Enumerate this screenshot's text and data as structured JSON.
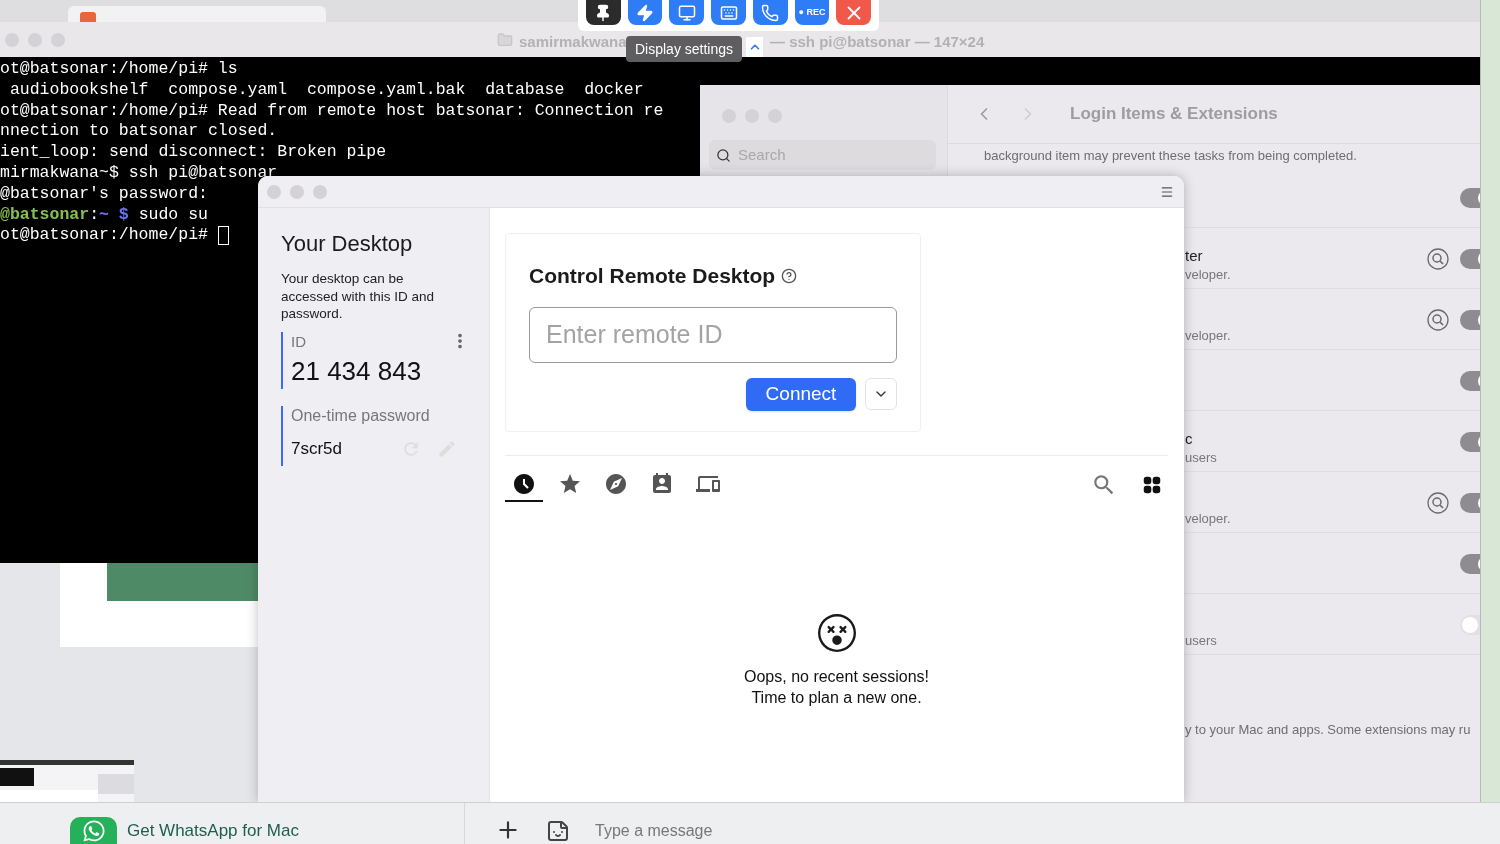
{
  "toolbar": {
    "buttons": [
      {
        "kind": "pin"
      },
      {
        "kind": "action"
      },
      {
        "kind": "display"
      },
      {
        "kind": "keyboard"
      },
      {
        "kind": "chat"
      },
      {
        "kind": "record",
        "label": "● REC"
      },
      {
        "kind": "close"
      }
    ],
    "tooltip": "Display settings"
  },
  "terminal": {
    "title_left": "samirmakwana",
    "title_right": "— ssh pi@batsonar — 147×24",
    "lines": [
      {
        "segments": [
          {
            "kind": "plain",
            "text": "ot@batsonar:/home/pi# ls"
          }
        ]
      },
      {
        "segments": [
          {
            "kind": "plain",
            "text": " audiobookshelf  compose.yaml  compose.yaml.bak  database  docker"
          }
        ]
      },
      {
        "segments": [
          {
            "kind": "plain",
            "text": "ot@batsonar:/home/pi# Read from remote host batsonar: Connection re"
          }
        ]
      },
      {
        "segments": [
          {
            "kind": "plain",
            "text": "nnection to batsonar closed."
          }
        ]
      },
      {
        "segments": [
          {
            "kind": "plain",
            "text": "ient_loop: send disconnect: Broken pipe"
          }
        ]
      },
      {
        "segments": [
          {
            "kind": "plain",
            "text": "mirmakwana~$ ssh pi@batsonar"
          }
        ]
      },
      {
        "segments": [
          {
            "kind": "plain",
            "text": "@batsonar's password:"
          }
        ]
      },
      {
        "segments": [
          {
            "kind": "host",
            "text": "@batsonar"
          },
          {
            "kind": "plain",
            "text": ":"
          },
          {
            "kind": "path",
            "text": "~ $"
          },
          {
            "kind": "plain",
            "text": " sudo su"
          }
        ]
      },
      {
        "segments": [
          {
            "kind": "plain",
            "text": "ot@batsonar:/home/pi# "
          }
        ],
        "cursor": true
      }
    ]
  },
  "settings": {
    "search_placeholder": "Search",
    "title": "Login Items & Extensions",
    "intro": "background item may prevent these tasks from being completed.",
    "rows": [
      {
        "on": true,
        "inspect": false
      },
      {
        "title": "ter",
        "subtitle": "veloper.",
        "on": true,
        "inspect": true
      },
      {
        "subtitle": "veloper.",
        "on": true,
        "inspect": true
      },
      {
        "on": true,
        "inspect": false
      },
      {
        "title": "c",
        "subtitle": "users",
        "on": true,
        "inspect": false
      },
      {
        "subtitle": "veloper.",
        "on": true,
        "inspect": true
      },
      {
        "on": true,
        "inspect": false
      },
      {
        "subtitle": "users",
        "on": false,
        "inspect": false
      }
    ],
    "footer": "y to your Mac and apps. Some extensions may ru"
  },
  "remote": {
    "your_desktop": {
      "title": "Your Desktop",
      "description": "Your desktop can be accessed with this ID and password.",
      "id_label": "ID",
      "id": "21 434 843",
      "password_label": "One-time password",
      "password": "7scr5d"
    },
    "control": {
      "title": "Control Remote Desktop",
      "placeholder": "Enter remote ID",
      "connect": "Connect"
    },
    "tabs": [
      {
        "kind": "recent",
        "selected": true
      },
      {
        "kind": "favorites",
        "selected": false
      },
      {
        "kind": "discovered",
        "selected": false
      },
      {
        "kind": "address_book",
        "selected": false
      },
      {
        "kind": "devices",
        "selected": false
      }
    ],
    "empty": [
      "Oops, no recent sessions!",
      "Time to plan a new one."
    ]
  },
  "chat_bar": {
    "promo": "Get WhatsApp for Mac",
    "placeholder": "Type a message"
  }
}
